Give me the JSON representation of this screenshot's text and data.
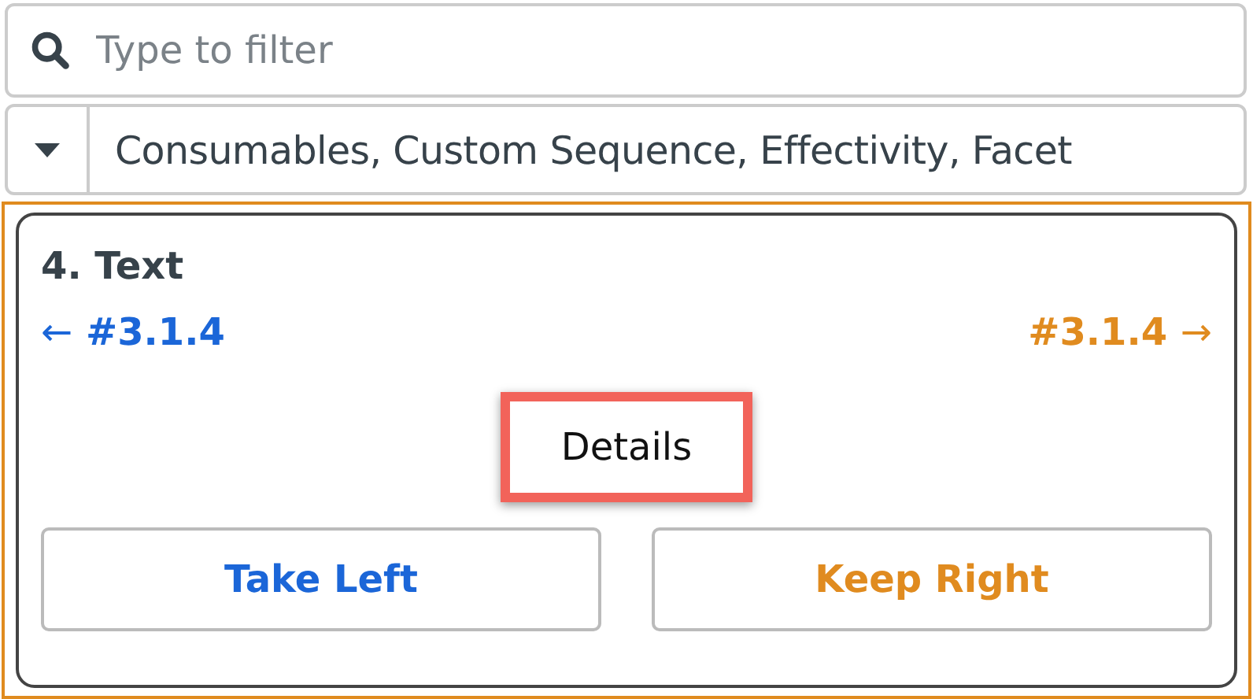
{
  "filter": {
    "placeholder": "Type to filter"
  },
  "dropdown": {
    "value": "Consumables, Custom Sequence, Effectivity, Facet"
  },
  "card": {
    "title": "4. Text",
    "selected": true,
    "left": {
      "arrow": "←",
      "ref": "#3.1.4"
    },
    "right": {
      "ref": "#3.1.4",
      "arrow": "→"
    },
    "details": {
      "label": "Details",
      "highlighted": true
    },
    "buttons": [
      {
        "label": "Take Left",
        "kind": "left"
      },
      {
        "label": "Keep Right",
        "kind": "right"
      }
    ]
  }
}
